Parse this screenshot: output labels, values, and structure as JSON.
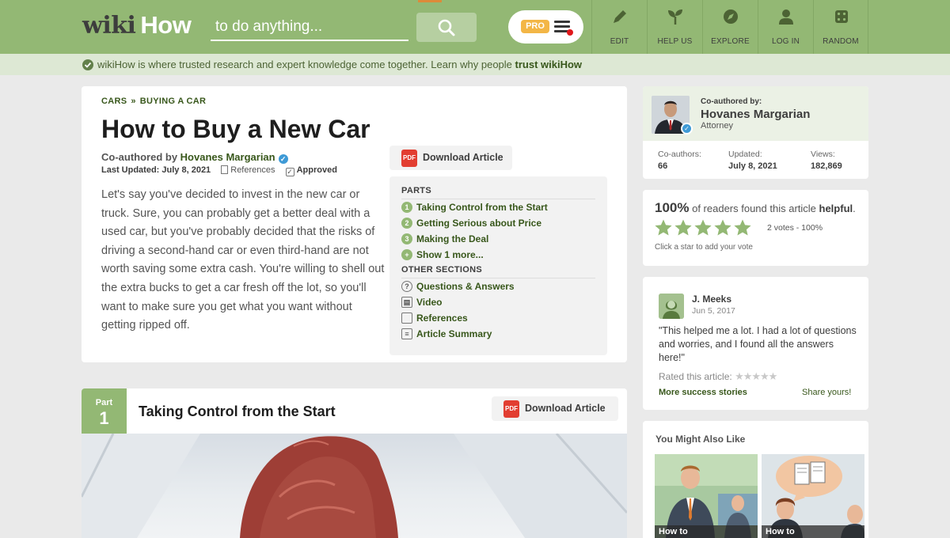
{
  "header": {
    "logo_wiki": "wiki",
    "logo_how": "How",
    "search_placeholder": "to do anything...",
    "pro_badge": "PRO",
    "nav": [
      {
        "label": "EDIT",
        "icon": "pencil-icon"
      },
      {
        "label": "HELP US",
        "icon": "sprout-icon"
      },
      {
        "label": "EXPLORE",
        "icon": "compass-icon"
      },
      {
        "label": "LOG IN",
        "icon": "user-icon"
      },
      {
        "label": "RANDOM",
        "icon": "dice-icon"
      }
    ]
  },
  "trust_bar": {
    "text": "wikiHow is where trusted research and expert knowledge come together. Learn why people ",
    "link": "trust wikiHow"
  },
  "article": {
    "breadcrumb": [
      "CARS",
      "BUYING A CAR"
    ],
    "breadcrumb_sep": "»",
    "title": "How to Buy a New Car",
    "coauthored_prefix": "Co-authored by ",
    "author": "Hovanes Margarian",
    "last_updated_label": "Last Updated:",
    "last_updated": "July 8, 2021",
    "references_label": "References",
    "approved_label": "Approved",
    "intro": "Let's say you've decided to invest in the new car or truck. Sure, you can probably get a better deal with a used car, but you've probably decided that the risks of driving a second-hand car or even third-hand are not worth saving some extra cash. You're willing to shell out the extra bucks to get a car fresh off the lot, so you'll want to make sure you get what you want without getting ripped off.",
    "download_label": "Download Article",
    "pdf_label": "PDF"
  },
  "toc": {
    "parts_head": "PARTS",
    "parts": [
      {
        "num": "1",
        "label": "Taking Control from the Start"
      },
      {
        "num": "2",
        "label": "Getting Serious about Price"
      },
      {
        "num": "3",
        "label": "Making the Deal"
      },
      {
        "num": "+",
        "label": "Show 1 more..."
      }
    ],
    "other_head": "OTHER SECTIONS",
    "other": [
      {
        "label": "Questions & Answers",
        "icon": "question-icon"
      },
      {
        "label": "Video",
        "icon": "video-icon"
      },
      {
        "label": "References",
        "icon": "document-icon"
      },
      {
        "label": "Article Summary",
        "icon": "summary-icon"
      }
    ]
  },
  "part": {
    "label": "Part",
    "num": "1",
    "title": "Taking Control from the Start",
    "download_label": "Download Article"
  },
  "author_card": {
    "coauthored_label": "Co-authored by:",
    "name": "Hovanes Margarian",
    "role": "Attorney",
    "stats": [
      {
        "label": "Co-authors:",
        "value": "66"
      },
      {
        "label": "Updated:",
        "value": "July 8, 2021"
      },
      {
        "label": "Views:",
        "value": "182,869"
      }
    ]
  },
  "helpful": {
    "percent": "100%",
    "text_mid": " of readers found this article ",
    "text_bold": "helpful",
    "text_end": ".",
    "stars_filled": 5,
    "votes": "2 votes - 100%",
    "hint": "Click a star to add your vote"
  },
  "story": {
    "name": "J. Meeks",
    "date": "Jun 5, 2017",
    "quote": "\"This helped me a lot. I had a lot of questions and worries, and I found all the answers here!\"",
    "rated_label": "Rated this article:",
    "more_link": "More success stories",
    "share_link": "Share yours!"
  },
  "also_like": {
    "heading": "You Might Also Like",
    "items": [
      {
        "label": "How to"
      },
      {
        "label": "How to"
      }
    ]
  },
  "colors": {
    "header_green": "#93b874",
    "link_green": "#38571b",
    "trust_bg": "#dde8d4",
    "pdf_red": "#e23e31",
    "pro_orange": "#f3b646"
  }
}
